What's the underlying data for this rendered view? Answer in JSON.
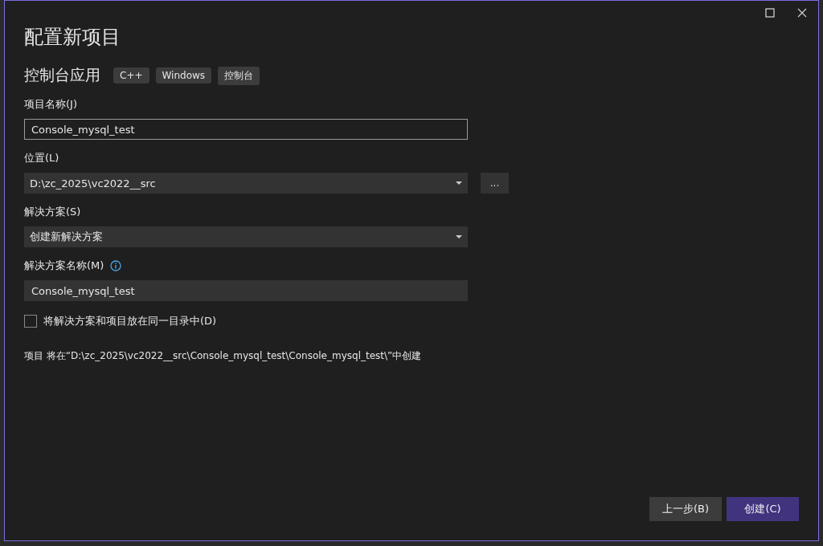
{
  "dialog": {
    "title": "配置新项目"
  },
  "template": {
    "name": "控制台应用",
    "tags": [
      "C++",
      "Windows",
      "控制台"
    ]
  },
  "fields": [
    {
      "kind": "text",
      "label": "项目名称(J)",
      "value": "Console_mysql_test",
      "focused": true
    },
    {
      "kind": "dropdown",
      "label": "位置(L)",
      "value": "D:\\zc_2025\\vc2022__src",
      "browse": "..."
    },
    {
      "kind": "dropdown",
      "label": "解决方案(S)",
      "value": "创建新解决方案"
    },
    {
      "kind": "text",
      "label": "解决方案名称(M)",
      "value": "Console_mysql_test",
      "info": true,
      "focused": false
    }
  ],
  "same_directory": {
    "label": "将解决方案和项目放在同一目录中(D)",
    "checked": false
  },
  "summary": "项目 将在“D:\\zc_2025\\vc2022__src\\Console_mysql_test\\Console_mysql_test\\”中创建",
  "buttons": [
    {
      "label": "上一步(B)",
      "primary": false
    },
    {
      "label": "创建(C)",
      "primary": true
    }
  ]
}
